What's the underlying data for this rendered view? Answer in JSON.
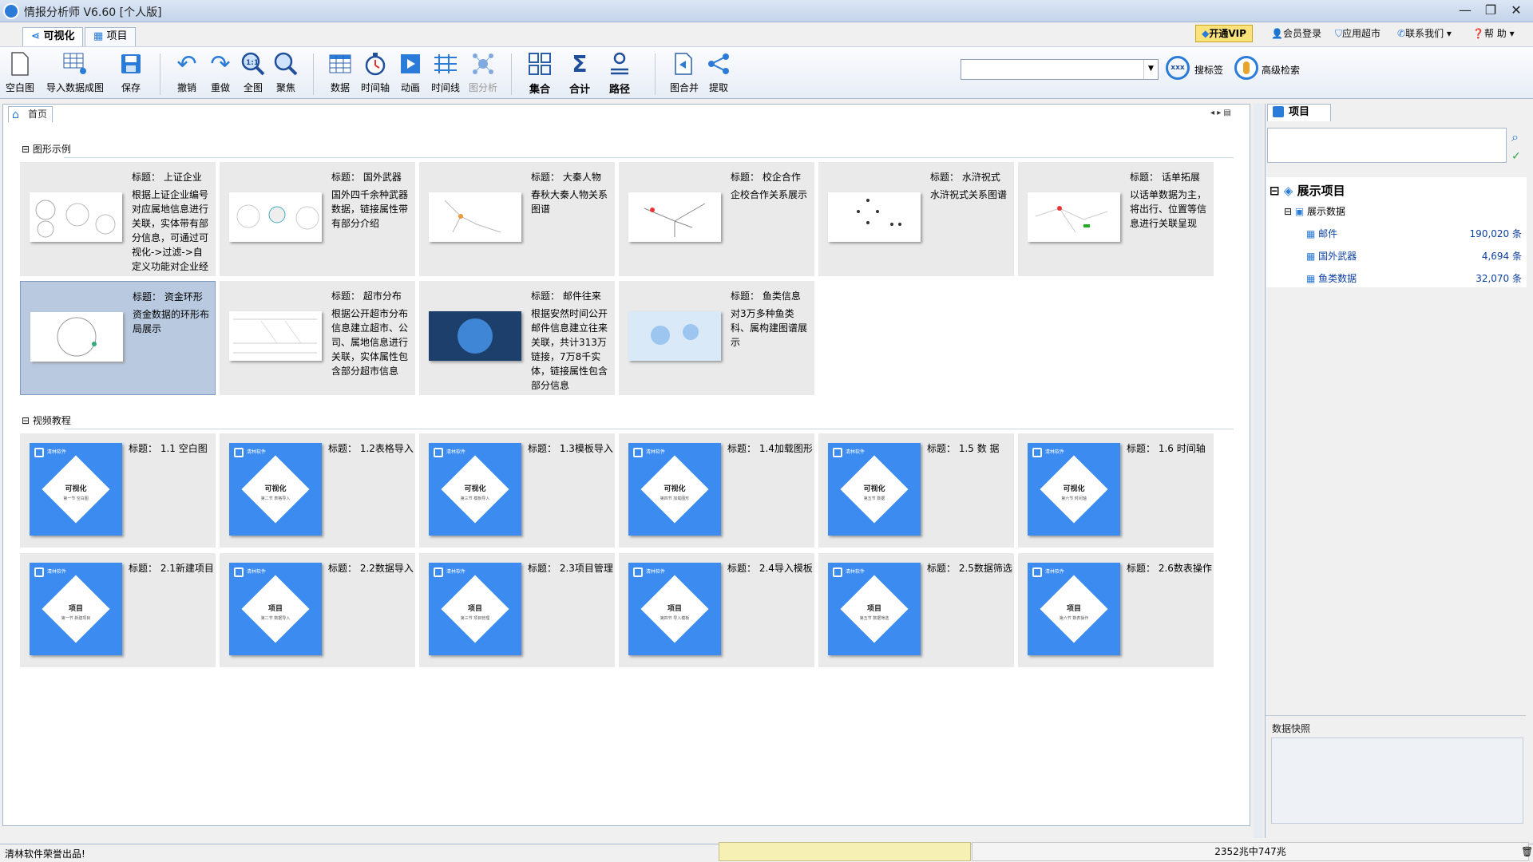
{
  "window": {
    "title": "情报分析师 V6.60 [个人版]"
  },
  "tabs": [
    {
      "label": "可视化"
    },
    {
      "label": "项目"
    }
  ],
  "topbar": {
    "vip": "开通VIP",
    "login": "会员登录",
    "apps": "应用超市",
    "contact": "联系我们",
    "help": "帮 助"
  },
  "toolbar": {
    "blank": "空白图",
    "import": "导入数据成图",
    "save": "保存",
    "undo": "撤销",
    "redo": "重做",
    "fit": "全图",
    "focus": "聚焦",
    "data": "数据",
    "timeline": "时间轴",
    "animation": "动画",
    "timelines": "时间线",
    "graph_analysis": "图分析",
    "collection": "集合",
    "sum": "合计",
    "path": "路径",
    "merge": "图合并",
    "extract": "提取",
    "search_label": "搜标签",
    "advanced_search": "高级检索",
    "search_value": ""
  },
  "home_tab": "首页",
  "sections": {
    "examples": "图形示例",
    "videos": "视频教程"
  },
  "examples": [
    {
      "title": "标题：  上证企业",
      "desc": "根据上证企业编号对应属地信息进行关联，实体带有部分信息，可通过可视化->过滤->自定义功能对企业经营、"
    },
    {
      "title": "标题：  国外武器",
      "desc": "国外四千余种武器数据，链接属性带有部分介绍"
    },
    {
      "title": "标题：  大秦人物",
      "desc": "春秋大秦人物关系图谱"
    },
    {
      "title": "标题：  校企合作",
      "desc": "企校合作关系展示"
    },
    {
      "title": "标题：  水浒祝式",
      "desc": "水浒祝式关系图谱"
    },
    {
      "title": "标题：  话单拓展",
      "desc": "以话单数据为主，将出行、位置等信息进行关联呈现"
    },
    {
      "title": "标题：  资金环形",
      "desc": "资金数据的环形布局展示"
    },
    {
      "title": "标题：  超市分布",
      "desc": "根据公开超市分布信息建立超市、公司、属地信息进行关联，实体属性包含部分超市信息"
    },
    {
      "title": "标题：  邮件往来",
      "desc": "根据安然时间公开邮件信息建立往来关联，共计313万链接，7万8千实体，链接属性包含部分信息"
    },
    {
      "title": "标题：  鱼类信息",
      "desc": "对3万多种鱼类科、属构建图谱展示"
    }
  ],
  "videos": [
    {
      "title": "标题：  1.1  空白图",
      "label": "可视化",
      "sub": "第一节  空白图"
    },
    {
      "title": "标题：  1.2表格导入",
      "label": "可视化",
      "sub": "第二节  表格导入"
    },
    {
      "title": "标题：  1.3模板导入",
      "label": "可视化",
      "sub": "第三节  模板导入"
    },
    {
      "title": "标题：  1.4加载图形",
      "label": "可视化",
      "sub": "第四节  加载图形"
    },
    {
      "title": "标题：  1.5  数    据",
      "label": "可视化",
      "sub": "第五节  数据"
    },
    {
      "title": "标题：  1.6  时间轴",
      "label": "可视化",
      "sub": "第六节  时间轴"
    },
    {
      "title": "标题：  2.1新建项目",
      "label": "项目",
      "sub": "第一节  新建项目"
    },
    {
      "title": "标题：  2.2数据导入",
      "label": "项目",
      "sub": "第二节  数据导入"
    },
    {
      "title": "标题：  2.3项目管理",
      "label": "项目",
      "sub": "第三节  项目管理"
    },
    {
      "title": "标题：  2.4导入模板",
      "label": "项目",
      "sub": "第四节  导入模板"
    },
    {
      "title": "标题：  2.5数据筛选",
      "label": "项目",
      "sub": "第五节  数据筛选"
    },
    {
      "title": "标题：  2.6数表操作",
      "label": "项目",
      "sub": "第六节  数表操作"
    }
  ],
  "video_brand": "清林软件",
  "right_panel": {
    "tab": "项目",
    "tree_root": "展示项目",
    "tree_folder": "展示数据",
    "items": [
      {
        "name": "邮件",
        "count": "190,020 条"
      },
      {
        "name": "国外武器",
        "count": "4,694 条"
      },
      {
        "name": "鱼类数据",
        "count": "32,070 条"
      }
    ],
    "snapshot": "数据快照"
  },
  "status": {
    "left": "清林软件荣誉出品!",
    "memory": "2352兆中747兆"
  }
}
